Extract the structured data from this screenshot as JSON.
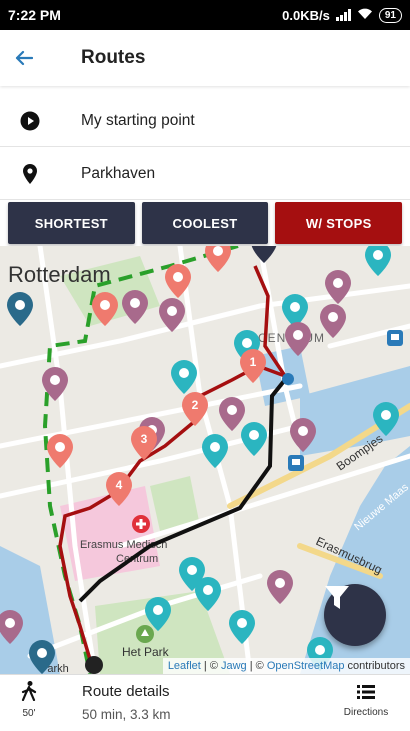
{
  "status": {
    "time": "7:22 PM",
    "speed": "0.0KB/s",
    "battery": "91"
  },
  "header": {
    "title": "Routes"
  },
  "start_field": {
    "value": "My starting point"
  },
  "destination_field": {
    "value": "Parkhaven"
  },
  "route_modes": [
    {
      "label": "SHORTEST",
      "color": "#2e3348"
    },
    {
      "label": "COOLEST",
      "color": "#2e3348"
    },
    {
      "label": "W/ STOPS",
      "color": "#a50f10"
    }
  ],
  "map": {
    "labels": {
      "city": "Rotterdam",
      "district": "CENTRUM",
      "hospital_line1": "Erasmus Medisch",
      "hospital_line2": "Centrum",
      "park": "Het Park",
      "street1": "Boompjes",
      "street2": "Erasmusbrug",
      "street3": "Nieuwe Maas",
      "street4": "Parkh"
    },
    "stops": [
      "1",
      "2",
      "3",
      "4"
    ],
    "colors": {
      "water": "#a9cde8",
      "park": "#cfe5c0",
      "hospital": "#f5c8dc",
      "red_route": "#a50f10",
      "black_route": "#111111",
      "green_route": "#2aa02a"
    },
    "attribution": {
      "leaflet": "Leaflet",
      "sep1": " | © ",
      "jawg": "Jawg",
      "sep2": " | © ",
      "osm": "OpenStreetMap",
      "tail": " contributors"
    }
  },
  "bottom": {
    "walk_time": "50'",
    "title": "Route details",
    "summary": "50 min, 3.3 km",
    "directions_label": "Directions"
  }
}
